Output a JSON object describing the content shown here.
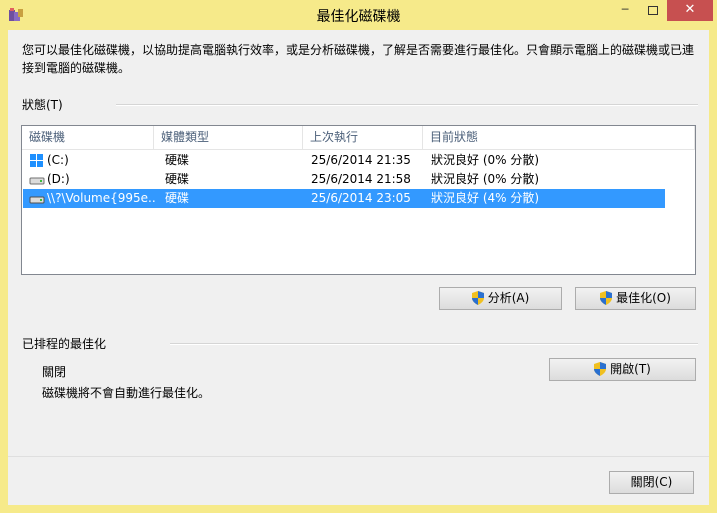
{
  "window": {
    "title": "最佳化磁碟機",
    "minimize": "─",
    "close": "✕"
  },
  "description": "您可以最佳化磁碟機，以協助提高電腦執行效率，或是分析磁碟機，了解是否需要進行最佳化。只會顯示電腦上的磁碟機或已連接到電腦的磁碟機。",
  "status_group": {
    "label": "狀態(T)"
  },
  "columns": {
    "drive": "磁碟機",
    "media": "媒體類型",
    "last_run": "上次執行",
    "current": "目前狀態"
  },
  "drives": [
    {
      "name": "(C:)",
      "media": "硬碟",
      "last_run": "25/6/2014 21:35",
      "status": "狀況良好 (0% 分散)",
      "icon": "windows-drive-icon"
    },
    {
      "name": "(D:)",
      "media": "硬碟",
      "last_run": "25/6/2014 21:58",
      "status": "狀況良好 (0% 分散)",
      "icon": "hard-drive-icon"
    },
    {
      "name": "\\\\?\\Volume{995e...",
      "media": "硬碟",
      "last_run": "25/6/2014 23:05",
      "status": "狀況良好 (4% 分散)",
      "icon": "hard-drive-icon"
    }
  ],
  "buttons": {
    "analyze": "分析(A)",
    "optimize": "最佳化(O)",
    "turn_on": "開啟(T)",
    "close": "關閉(C)"
  },
  "schedule_group": {
    "label": "已排程的最佳化",
    "state": "關閉",
    "detail": "磁碟機將不會自動進行最佳化。"
  },
  "colors": {
    "titlebar": "#f6ea8a",
    "selection": "#3399ff",
    "close_button": "#c75050"
  }
}
